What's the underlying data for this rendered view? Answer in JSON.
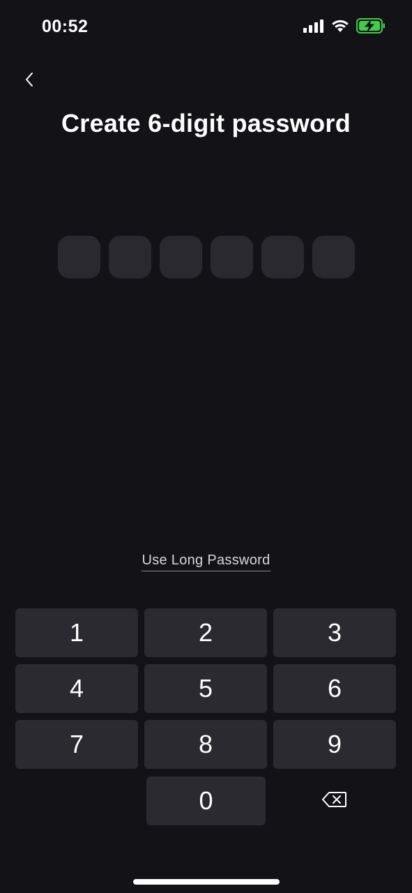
{
  "status_bar": {
    "time": "00:52",
    "icons": [
      "cellular-signal-icon",
      "wifi-icon",
      "battery-charging-icon"
    ],
    "battery_color": "#3ecf4a"
  },
  "header": {
    "back_icon": "chevron-left-icon",
    "title": "Create 6-digit password"
  },
  "pin": {
    "length": 6,
    "filled": 0
  },
  "link": {
    "label": "Use Long Password"
  },
  "keypad": {
    "keys": [
      "1",
      "2",
      "3",
      "4",
      "5",
      "6",
      "7",
      "8",
      "9",
      "0"
    ],
    "delete_icon": "backspace-icon"
  },
  "colors": {
    "background": "#131217",
    "key_background": "#2b2a30",
    "pin_box": "#2a292f"
  }
}
